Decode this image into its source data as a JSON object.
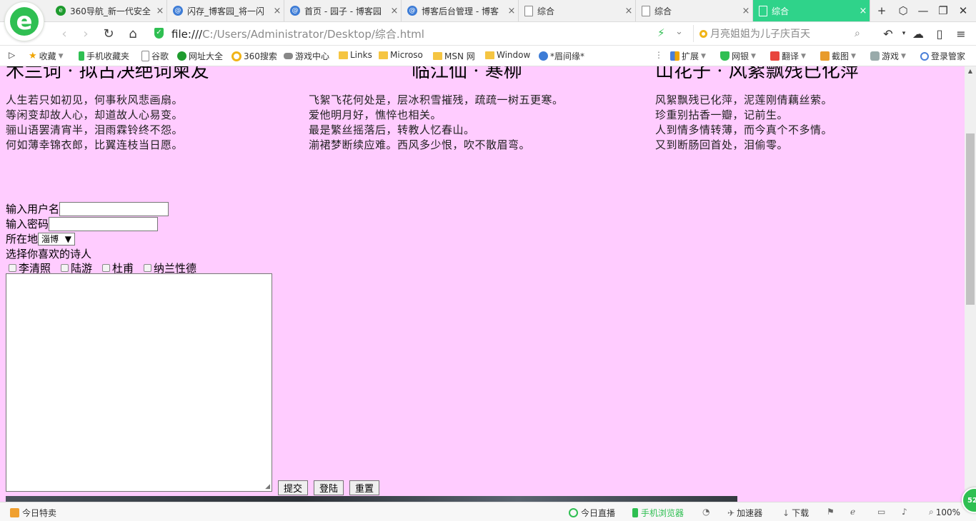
{
  "browser": {
    "logo_letter": "e",
    "tabs": [
      {
        "label": "360导航_新一代安全",
        "icon": "nav360",
        "active": false
      },
      {
        "label": "闪存_博客园_将一闪",
        "icon": "cnblogs",
        "active": false
      },
      {
        "label": "首页 - 园子 - 博客园",
        "icon": "cnblogs",
        "active": false
      },
      {
        "label": "博客后台管理 - 博客",
        "icon": "cnblogs",
        "active": false
      },
      {
        "label": "综合",
        "icon": "page",
        "active": false
      },
      {
        "label": "综合",
        "icon": "page",
        "active": false
      },
      {
        "label": "综合",
        "icon": "page",
        "active": true
      }
    ],
    "tab_close": "×",
    "new_tab": "+",
    "window_controls": {
      "restore_icon": "⬡",
      "minimize": "—",
      "maximize": "❐",
      "close": "✕"
    },
    "url_prefix": "file:///",
    "url_rest": "C:/Users/Administrator/Desktop/综合.html",
    "search_suggestion": "月亮姐姐为儿子庆百天",
    "accent_color": "#2fd38a"
  },
  "bookmarks": [
    {
      "label": "收藏",
      "icon": "star",
      "caret": true
    },
    {
      "label": "手机收藏夹",
      "icon": "phone"
    },
    {
      "label": "谷歌",
      "icon": "doc"
    },
    {
      "label": "网址大全",
      "icon": "c360"
    },
    {
      "label": "360搜索",
      "icon": "ring"
    },
    {
      "label": "游戏中心",
      "icon": "game"
    },
    {
      "label": "Links",
      "icon": "folder"
    },
    {
      "label": "Microso",
      "icon": "folder"
    },
    {
      "label": "MSN 网",
      "icon": "folder"
    },
    {
      "label": "Window",
      "icon": "folder"
    },
    {
      "label": "*眉间缘*",
      "icon": "cnb"
    }
  ],
  "bookmark_tools": [
    {
      "label": "扩展",
      "icon": "grid"
    },
    {
      "label": "网银",
      "icon": "shieldg"
    },
    {
      "label": "翻译",
      "icon": "trans"
    },
    {
      "label": "截图",
      "icon": "cut"
    },
    {
      "label": "游戏",
      "icon": "joy"
    },
    {
      "label": "登录管家",
      "icon": "mag"
    }
  ],
  "page": {
    "background": "#ffccff",
    "poems": [
      {
        "title": "木兰词 · 拟古决绝词柬友",
        "lines": [
          "人生若只如初见，何事秋风悲画扇。",
          "等闲变却故人心，却道故人心易变。",
          "骊山语罢清宵半，泪雨霖铃终不怨。",
          "何如薄幸锦衣郎，比翼连枝当日愿。"
        ]
      },
      {
        "title": "临江仙 · 寒柳",
        "lines": [
          "飞絮飞花何处是，层冰积雪摧残，疏疏一树五更寒。",
          "爱他明月好，憔悴也相关。",
          "最是繁丝摇落后，转教人忆春山。",
          "湔裙梦断续应难。西风多少恨，吹不散眉弯。"
        ]
      },
      {
        "title": "山花子 · 风絮飘残已化萍",
        "lines": [
          "风絮飘残已化萍，泥莲刚倩藕丝萦。",
          "珍重别拈香一瓣，记前生。",
          "人到情多情转薄，而今真个不多情。",
          "又到断肠回首处，泪偷零。"
        ]
      }
    ],
    "form": {
      "username_label": "输入用户名",
      "username_value": "",
      "password_label": "输入密码",
      "password_value": "",
      "location_label": "所在地",
      "location_selected": "淄博",
      "poets_label": "选择你喜欢的诗人",
      "poets": [
        "李清照",
        "陆游",
        "杜甫",
        "纳兰性德"
      ],
      "textarea_value": "",
      "submit": "提交",
      "login": "登陆",
      "reset": "重置"
    }
  },
  "statusbar": {
    "left": "今日特卖",
    "items": [
      "今日直播",
      "手机浏览器",
      "",
      "加速器",
      "下载"
    ],
    "zoom": "100%",
    "float_badge": "52"
  }
}
